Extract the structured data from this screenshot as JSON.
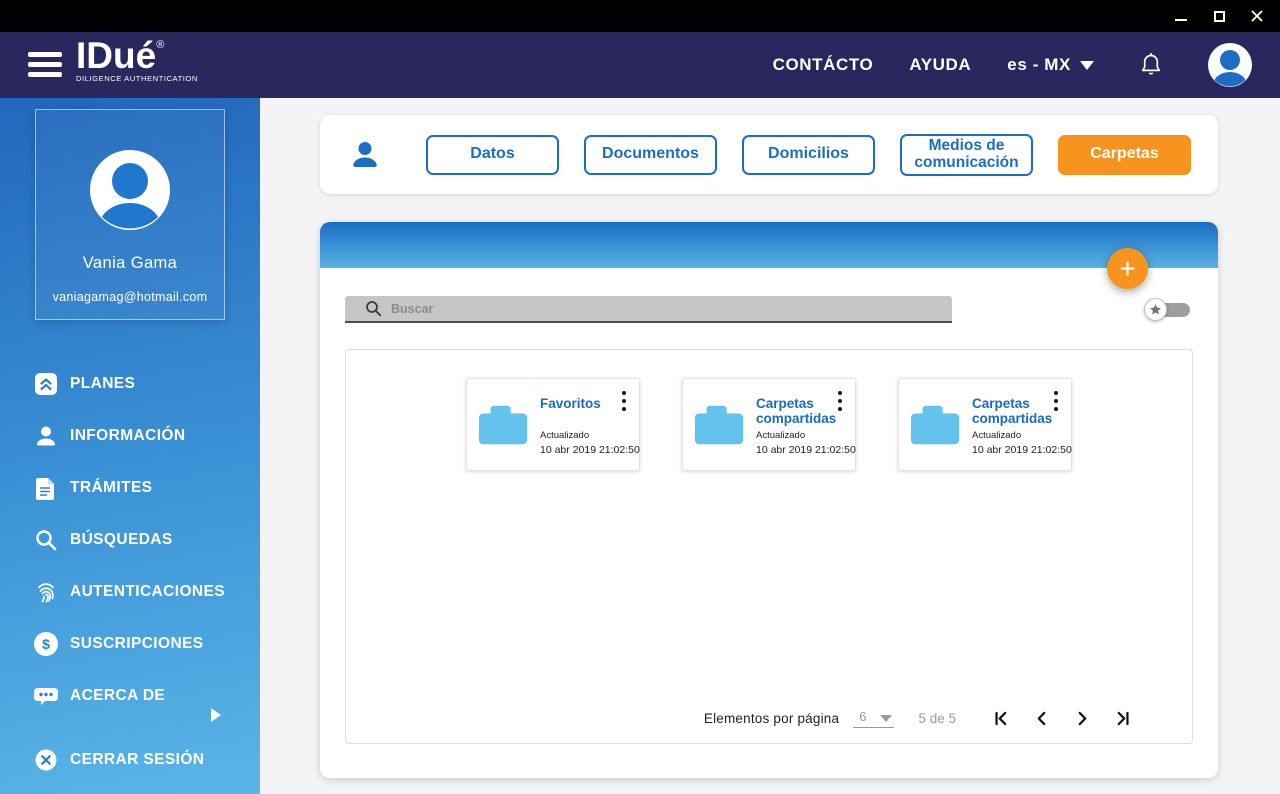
{
  "header": {
    "brand": "IDué",
    "registered": "®",
    "tagline": "DILIGENCE AUTHENTICATION",
    "nav_contact": "CONTÁCTO",
    "nav_help": "AYUDA",
    "language": "es - MX"
  },
  "sidebar": {
    "profile": {
      "name": "Vania Gama",
      "email": "vaniagamag@hotmail.com"
    },
    "items": [
      {
        "label": "PLANES",
        "icon": "plans-icon"
      },
      {
        "label": "INFORMACIÓN",
        "icon": "person-icon"
      },
      {
        "label": "TRÁMITES",
        "icon": "document-icon"
      },
      {
        "label": "BÚSQUEDAS",
        "icon": "search-icon"
      },
      {
        "label": "AUTENTICACIONES",
        "icon": "fingerprint-icon"
      },
      {
        "label": "SUSCRIPCIONES",
        "icon": "dollar-icon"
      },
      {
        "label": "ACERCA DE",
        "icon": "chat-icon"
      },
      {
        "label": "CERRAR SESIÓN",
        "icon": "logout-icon"
      }
    ]
  },
  "tabs": {
    "items": [
      {
        "label": "Datos",
        "active": false
      },
      {
        "label": "Documentos",
        "active": false
      },
      {
        "label": "Domicilios",
        "active": false
      },
      {
        "label": "Medios de comunicación",
        "active": false
      },
      {
        "label": "Carpetas",
        "active": true
      }
    ]
  },
  "folders_panel": {
    "add_label": "+",
    "search_placeholder": "Buscar",
    "search_value": "",
    "folders": [
      {
        "title": "Favoritos",
        "updated_label": "Actualizado",
        "updated_at": "10 abr 2019 21:02:50"
      },
      {
        "title": "Carpetas compartidas",
        "updated_label": "Actualizado",
        "updated_at": "10 abr 2019 21:02:50"
      },
      {
        "title": "Carpetas compartidas",
        "updated_label": "Actualizado",
        "updated_at": "10 abr 2019 21:02:50"
      }
    ],
    "pagination": {
      "items_per_page_label": "Elementos por página",
      "items_per_page_value": "6",
      "range_label": "5 de 5"
    }
  },
  "icons": {
    "dollar": "$"
  },
  "colors": {
    "header_navy": "#2a265e",
    "accent_blue": "#1b6ec2",
    "orange": "#f7941f",
    "folder_blue": "#63c3ed",
    "sidebar_top": "#2267bc",
    "sidebar_bottom": "#5bb5e7"
  }
}
